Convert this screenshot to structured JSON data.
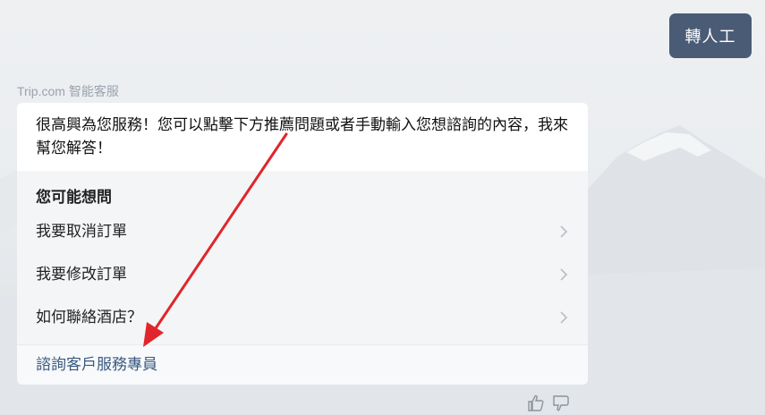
{
  "header": {
    "transfer_button_label": "轉人工"
  },
  "bot": {
    "name": "Trip.com 智能客服"
  },
  "message": {
    "greeting": "很高興為您服務！您可以點擊下方推薦問題或者手動輸入您想諮詢的內容，我來幫您解答！"
  },
  "suggestions": {
    "title": "您可能想問",
    "items": [
      {
        "label": "我要取消訂單"
      },
      {
        "label": "我要修改訂單"
      },
      {
        "label": "如何聯絡酒店？"
      }
    ]
  },
  "agent_link": {
    "label": "諮詢客戶服務專員"
  },
  "feedback": {
    "like_icon": "thumbs-up-icon",
    "dislike_icon": "thumbs-down-icon"
  },
  "annotation": {
    "arrow_color": "#e0262b"
  },
  "colors": {
    "transfer_button_bg": "#4a5b76",
    "link_color": "#3a5a80"
  }
}
